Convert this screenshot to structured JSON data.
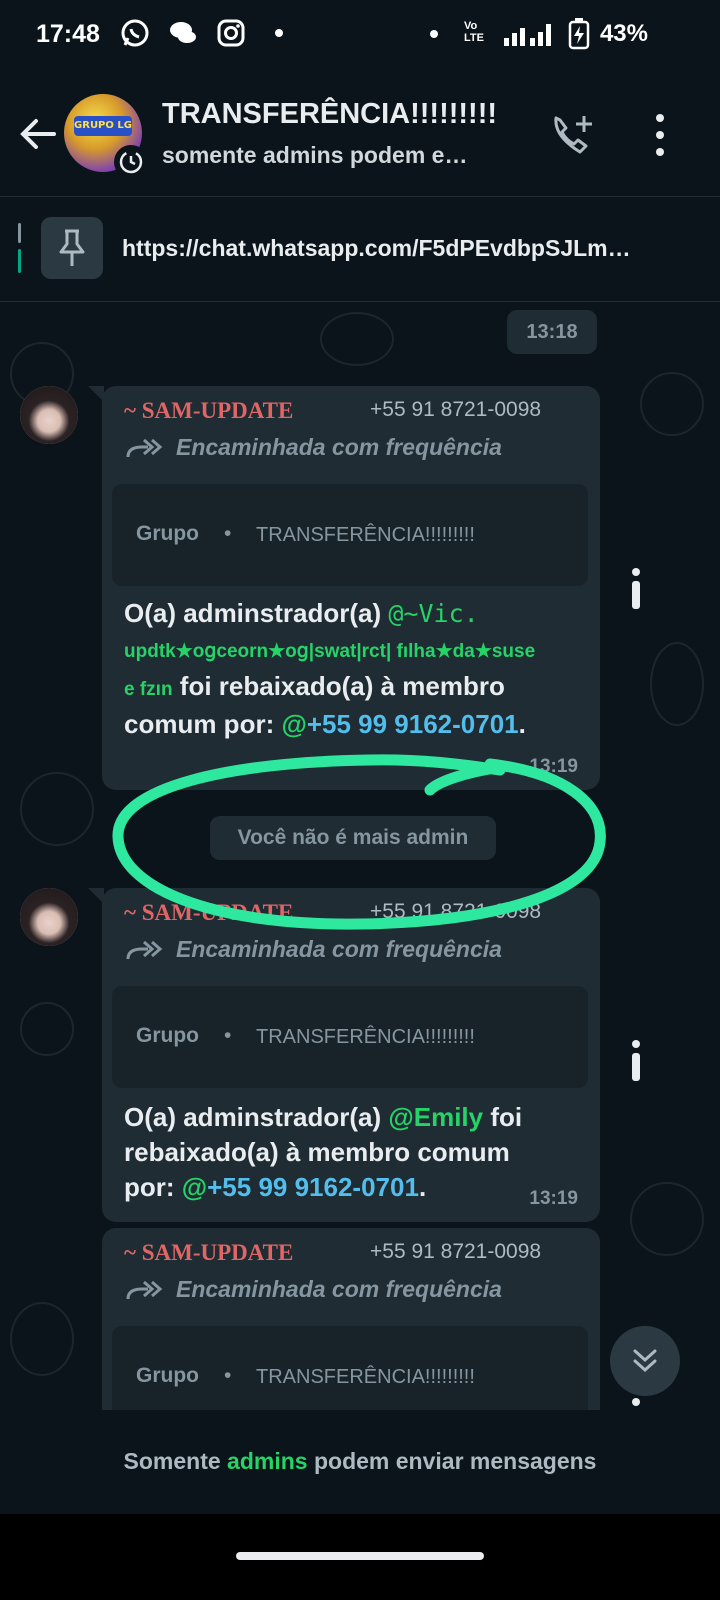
{
  "status_bar": {
    "time": "17:48",
    "battery": "43%",
    "icons": [
      "whatsapp-icon",
      "chat-bubbles-icon",
      "instagram-icon",
      "dot-icon",
      "dot-icon",
      "volte-icon",
      "signal-icon",
      "battery-charging-icon"
    ],
    "volte_label": "Vo LTE"
  },
  "header": {
    "title": "TRANSFERÊNCIA!!!!!!!!!",
    "subtitle": "somente admins podem e…",
    "avatar_text": "GRUPO LG"
  },
  "pinned": {
    "link": "https://chat.whatsapp.com/F5dPEvdbpSJLm…"
  },
  "chat": {
    "date_chip": "13:18",
    "system_message": "Você não é mais admin",
    "messages": [
      {
        "sender": "~ SAM-UPDATE",
        "phone": "+55 91 8721-0098",
        "forwarded_label": "Encaminhada com frequência",
        "quote_label": "Grupo",
        "quote_dot": "•",
        "quote_name": "TRANSFERÊNCIA!!!!!!!!!",
        "text_prefix": "O(a) adminstrador(a) ",
        "mention_name": "@~Vic.",
        "mention_line2": "updtk★oցceorn★oց|swat|rct| fılha★da★suse",
        "mention_line3": "e fzın",
        "text_mid": " foi rebaixado(a) à membro comum por: ",
        "mention_by_at": "@",
        "mention_by_num": "+55 99 9162-0701",
        "text_end": ".",
        "time": "13:19"
      },
      {
        "sender": "~ SAM-UPDATE",
        "phone": "+55 91 8721-0098",
        "forwarded_label": "Encaminhada com frequência",
        "quote_label": "Grupo",
        "quote_dot": "•",
        "quote_name": "TRANSFERÊNCIA!!!!!!!!!",
        "text_prefix": "O(a) adminstrador(a) ",
        "mention_name": "@Emily",
        "text_mid_a": " foi",
        "text_mid_b": "rebaixado(a) à membro comum",
        "text_mid_c": "por: ",
        "mention_by_at": "@",
        "mention_by_num": "+55 99 9162-0701",
        "text_end": ".",
        "time": "13:19"
      },
      {
        "sender": "~ SAM-UPDATE",
        "phone": "+55 91 8721-0098",
        "forwarded_label": "Encaminhada com frequência",
        "quote_label": "Grupo",
        "quote_dot": "•",
        "quote_name": "TRANSFERÊNCIA!!!!!!!!!"
      }
    ]
  },
  "footer": {
    "prefix": "Somente ",
    "link": "admins",
    "suffix": " podem enviar mensagens"
  },
  "colors": {
    "background": "#0b141a",
    "bubble": "#1f2c33",
    "accent_green": "#25d366",
    "link_blue": "#53bdeb",
    "sender_red": "#e06666",
    "annotation_circle": "#2ee8a0"
  }
}
